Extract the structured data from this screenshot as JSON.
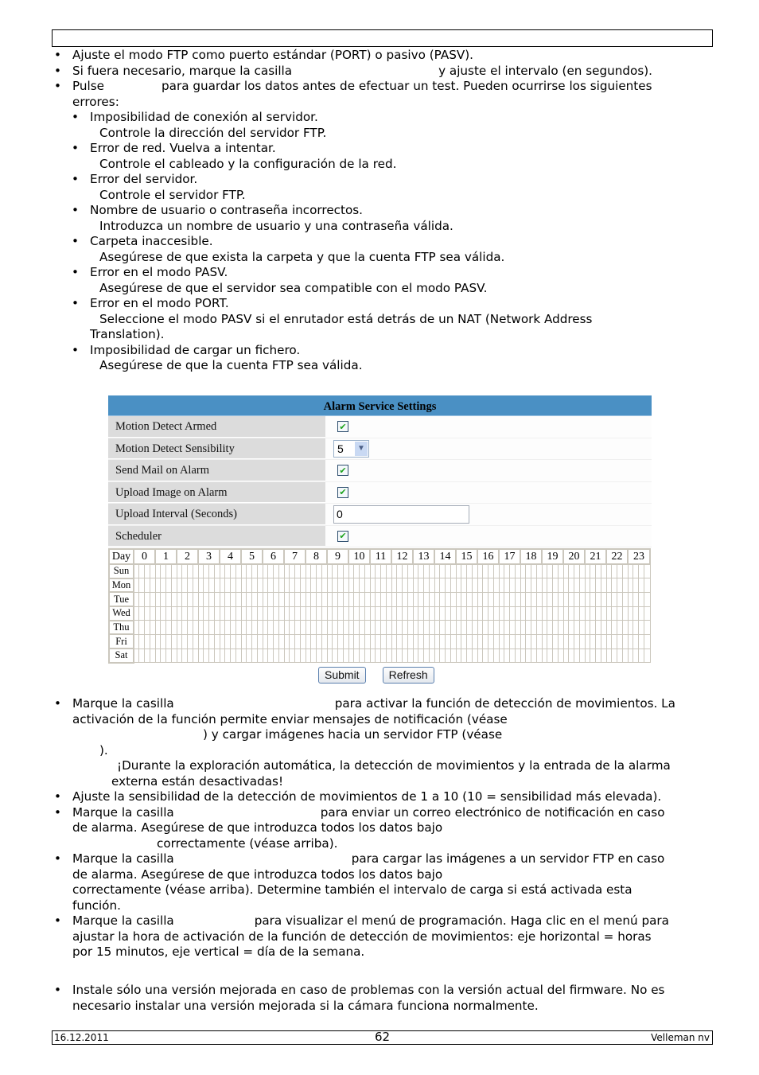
{
  "top_bullets": [
    {
      "text": "Ajuste el modo FTP como puerto estándar (PORT) o pasivo (PASV)."
    },
    {
      "pre": "Si fuera necesario, marque la casilla",
      "post": "y ajuste el intervalo (en segundos)."
    },
    {
      "pre": "Pulse",
      "post": "para guardar los datos antes de efectuar un test. Pueden ocurrirse los siguientes",
      "cont": "errores:"
    }
  ],
  "errors": [
    {
      "title": "Imposibilidad de conexión al servidor.",
      "note": "Controle la dirección del servidor FTP."
    },
    {
      "title": "Error de red. Vuelva a intentar.",
      "note": "Controle el cableado y la configuración de la red."
    },
    {
      "title": "Error del servidor.",
      "note": "Controle el servidor FTP."
    },
    {
      "title": "Nombre de usuario o contraseña incorrectos.",
      "note": "Introduzca un nombre de usuario y una contraseña válida."
    },
    {
      "title": "Carpeta inaccesible.",
      "note": "Asegúrese de que exista la carpeta y que la cuenta FTP sea válida."
    },
    {
      "title": "Error en el modo PASV.",
      "note": "Asegúrese de que el servidor sea compatible con el modo PASV."
    },
    {
      "title": "Error en el modo PORT.",
      "note": "Seleccione el modo PASV si el enrutador está detrás de un NAT (Network Address",
      "note_cont": "Translation)."
    },
    {
      "title": "Imposibilidad de cargar un fichero.",
      "note": "Asegúrese de que la cuenta FTP sea válida."
    }
  ],
  "panel": {
    "title": "Alarm Service Settings",
    "rows": [
      {
        "label": "Motion Detect Armed",
        "type": "checkbox",
        "checked": true
      },
      {
        "label": "Motion Detect Sensibility",
        "type": "select",
        "value": "5"
      },
      {
        "label": "Send Mail on Alarm",
        "type": "checkbox",
        "checked": true
      },
      {
        "label": "Upload Image on Alarm",
        "type": "checkbox",
        "checked": true
      },
      {
        "label": "Upload Interval (Seconds)",
        "type": "text",
        "value": "0"
      },
      {
        "label": "Scheduler",
        "type": "checkbox",
        "checked": true
      }
    ],
    "check_glyph": "✔",
    "select_arrow": "▼",
    "schedule": {
      "day_header": "Day",
      "hours": [
        "0",
        "1",
        "2",
        "3",
        "4",
        "5",
        "6",
        "7",
        "8",
        "9",
        "10",
        "11",
        "12",
        "13",
        "14",
        "15",
        "16",
        "17",
        "18",
        "19",
        "20",
        "21",
        "22",
        "23"
      ],
      "days": [
        "Sun",
        "Mon",
        "Tue",
        "Wed",
        "Thu",
        "Fri",
        "Sat"
      ],
      "slots_per_hour": 4
    },
    "buttons": {
      "submit": "Submit",
      "refresh": "Refresh"
    }
  },
  "lower_bullets": {
    "b1_pre": "Marque la casilla",
    "b1_post": "para activar la función de detección de movimientos. La",
    "b1_line2": "activación de la función permite enviar mensajes de notificación (véase",
    "b1_line3": ") y cargar imágenes hacia un servidor FTP (véase",
    "b1_line4": ").",
    "b1_note1": "¡Durante la exploración automática, la detección de movimientos y la entrada de la alarma",
    "b1_note2": "externa están desactivadas!",
    "b2": "Ajuste la sensibilidad de la detección de movimientos de 1 a 10 (10 = sensibilidad más elevada).",
    "b3_pre": "Marque la casilla",
    "b3_post": "para enviar un correo electrónico de notificación en caso",
    "b3_line2": "de alarma. Asegúrese de que introduzca todos los datos bajo",
    "b3_line3": "correctamente (véase arriba).",
    "b4_pre": "Marque la casilla",
    "b4_post": "para cargar las imágenes a un servidor FTP en caso",
    "b4_line2": "de alarma. Asegúrese de que introduzca todos los datos bajo",
    "b4_line3": "correctamente (véase arriba). Determine también el intervalo de carga si está activada esta",
    "b4_line4": "función.",
    "b5_pre": "Marque la casilla",
    "b5_post": "para visualizar el menú de programación. Haga clic en el menú para",
    "b5_line2": "ajustar la hora de activación de la función de detección de movimientos: eje horizontal = horas",
    "b5_line3": "por 15 minutos, eje vertical = día de la semana."
  },
  "firmware_bullet": {
    "line1": "Instale sólo una versión mejorada en caso de problemas con la versión actual del firmware. No es",
    "line2": "necesario instalar una versión mejorada si la cámara funciona normalmente."
  },
  "footer": {
    "date": "16.12.2011",
    "page": "62",
    "company": "Velleman nv"
  },
  "bullet_glyph": "•"
}
